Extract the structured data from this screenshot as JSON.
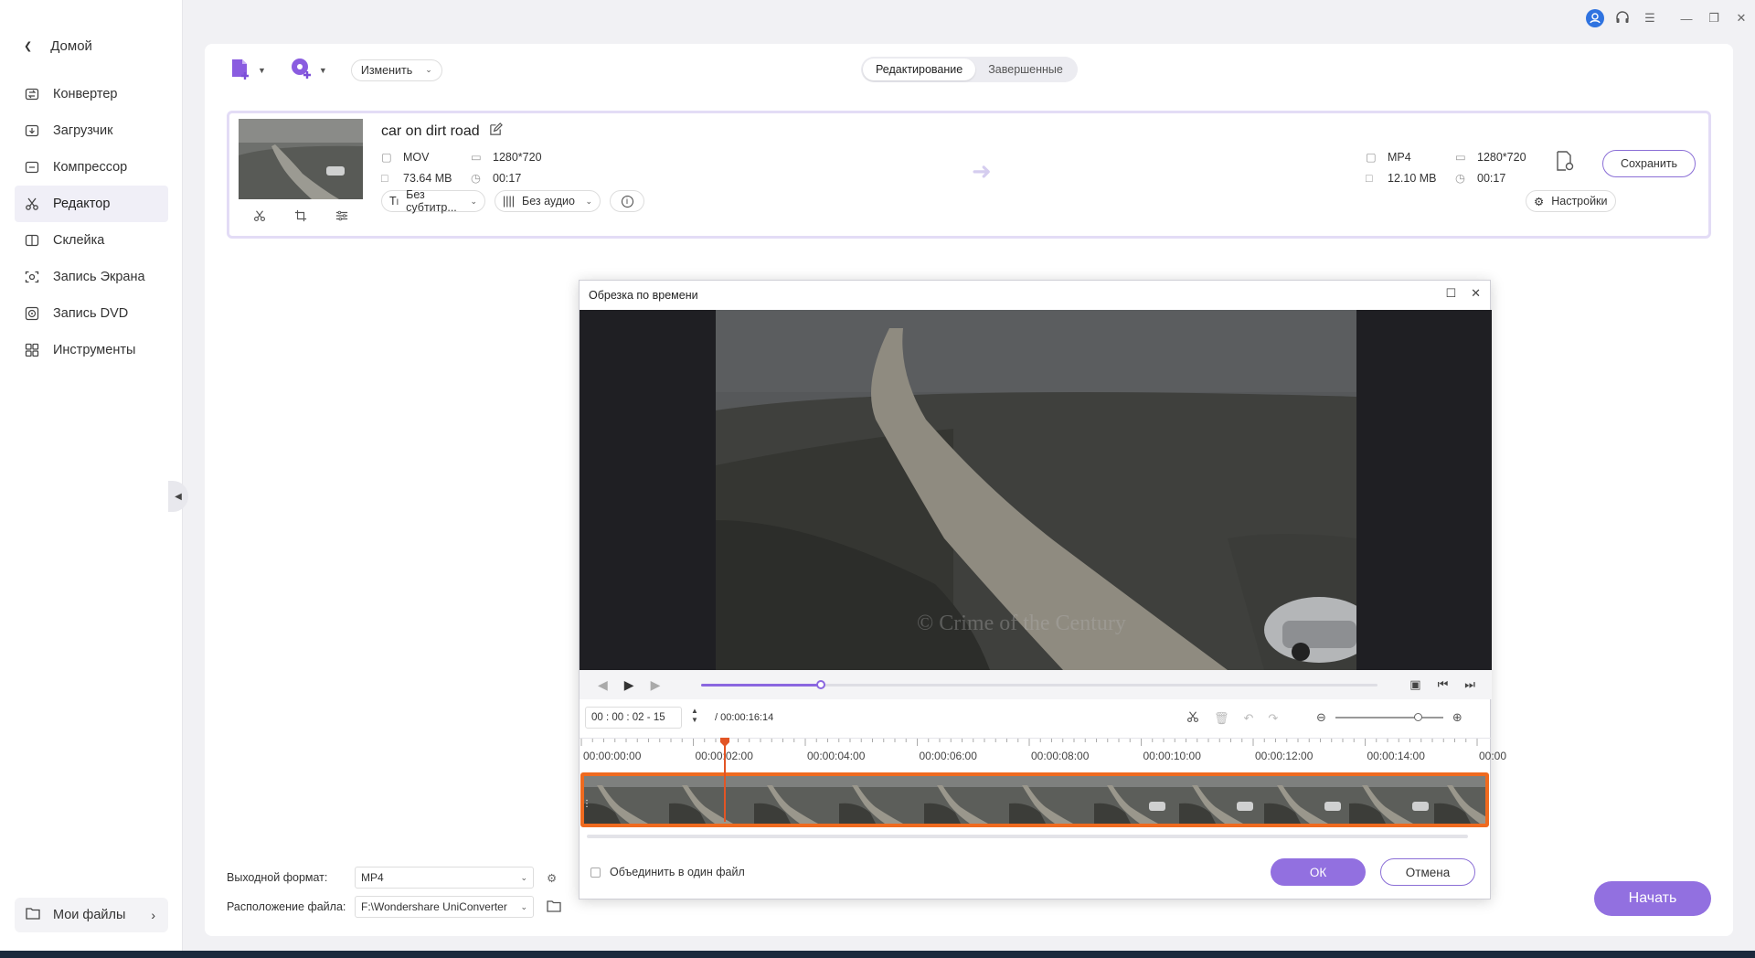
{
  "sidebar": {
    "home_label": "Домой",
    "items": [
      {
        "label": "Конвертер",
        "icon": "converter-icon"
      },
      {
        "label": "Загрузчик",
        "icon": "download-icon"
      },
      {
        "label": "Компрессор",
        "icon": "compress-icon"
      },
      {
        "label": "Редактор",
        "icon": "scissors-icon",
        "active": true
      },
      {
        "label": "Склейка",
        "icon": "merge-icon"
      },
      {
        "label": "Запись Экрана",
        "icon": "screen-record-icon"
      },
      {
        "label": "Запись DVD",
        "icon": "dvd-icon"
      },
      {
        "label": "Инструменты",
        "icon": "tools-icon"
      }
    ],
    "my_files_label": "Мои файлы"
  },
  "toolbar": {
    "edit_select": "Изменить",
    "tabs": [
      {
        "label": "Редактирование",
        "active": true
      },
      {
        "label": "Завершенные",
        "active": false
      }
    ]
  },
  "file": {
    "name": "car on dirt road",
    "source": {
      "format": "MOV",
      "resolution": "1280*720",
      "size": "73.64 MB",
      "duration": "00:17"
    },
    "target": {
      "format": "MP4",
      "resolution": "1280*720",
      "size": "12.10 MB",
      "duration": "00:17"
    },
    "save_label": "Сохранить",
    "subtitle_option": "Без субтитр...",
    "audio_option": "Без аудио",
    "settings_label": "Настройки"
  },
  "bottom": {
    "output_format_label": "Выходной формат:",
    "output_format_value": "MP4",
    "location_label": "Расположение файла:",
    "location_value": "F:\\Wondershare UniConverter",
    "start_label": "Начать"
  },
  "dialog": {
    "title": "Обрезка по времени",
    "watermark": "© Crime of the Century",
    "progress": 0.177,
    "timecode": {
      "h": "00",
      "m": "00",
      "s": "02",
      "f": "15"
    },
    "total": "/ 00:00:16:14",
    "ruler_labels": [
      "00:00:00:00",
      "00:00:02:00",
      "00:00:04:00",
      "00:00:06:00",
      "00:00:08:00",
      "00:00:10:00",
      "00:00:12:00",
      "00:00:14:00",
      "00:00"
    ],
    "playhead_seconds": 2.6,
    "merge_label": "Объединить в один файл",
    "ok_label": "ОК",
    "cancel_label": "Отмена"
  },
  "colors": {
    "accent": "#9270e0",
    "trim_border": "#ef6a1f",
    "playhead": "#e25525"
  }
}
